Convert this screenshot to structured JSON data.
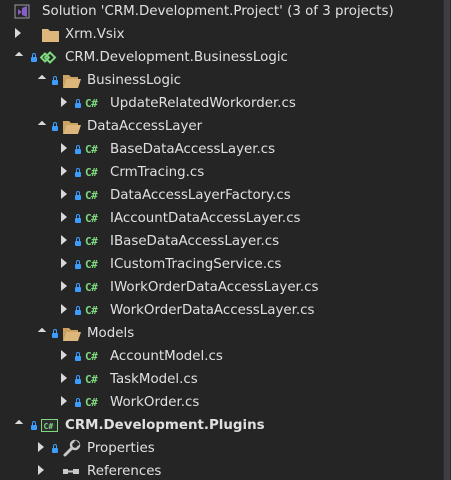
{
  "solution_explorer": {
    "solution": "Solution 'CRM.Development.Project' (3 of 3 projects)",
    "items": [
      {
        "label": "Xrm.Vsix"
      },
      {
        "label": "CRM.Development.BusinessLogic"
      },
      {
        "label": "BusinessLogic"
      },
      {
        "label": "UpdateRelatedWorkorder.cs"
      },
      {
        "label": "DataAccessLayer"
      },
      {
        "label": "BaseDataAccessLayer.cs"
      },
      {
        "label": "CrmTracing.cs"
      },
      {
        "label": "DataAccessLayerFactory.cs"
      },
      {
        "label": "IAccountDataAccessLayer.cs"
      },
      {
        "label": "IBaseDataAccessLayer.cs"
      },
      {
        "label": "ICustomTracingService.cs"
      },
      {
        "label": "IWorkOrderDataAccessLayer.cs"
      },
      {
        "label": "WorkOrderDataAccessLayer.cs"
      },
      {
        "label": "Models"
      },
      {
        "label": "AccountModel.cs"
      },
      {
        "label": "TaskModel.cs"
      },
      {
        "label": "WorkOrder.cs"
      },
      {
        "label": "CRM.Development.Plugins"
      },
      {
        "label": "Properties"
      },
      {
        "label": "References"
      }
    ],
    "csharp_badge": "C#",
    "colors": {
      "background": "#252526",
      "text": "#e0e0e0",
      "folder": "#dcb67a",
      "csharp": "#7ed87e",
      "lock": "#3c9dff",
      "vs_purple": "#865fc5"
    }
  }
}
